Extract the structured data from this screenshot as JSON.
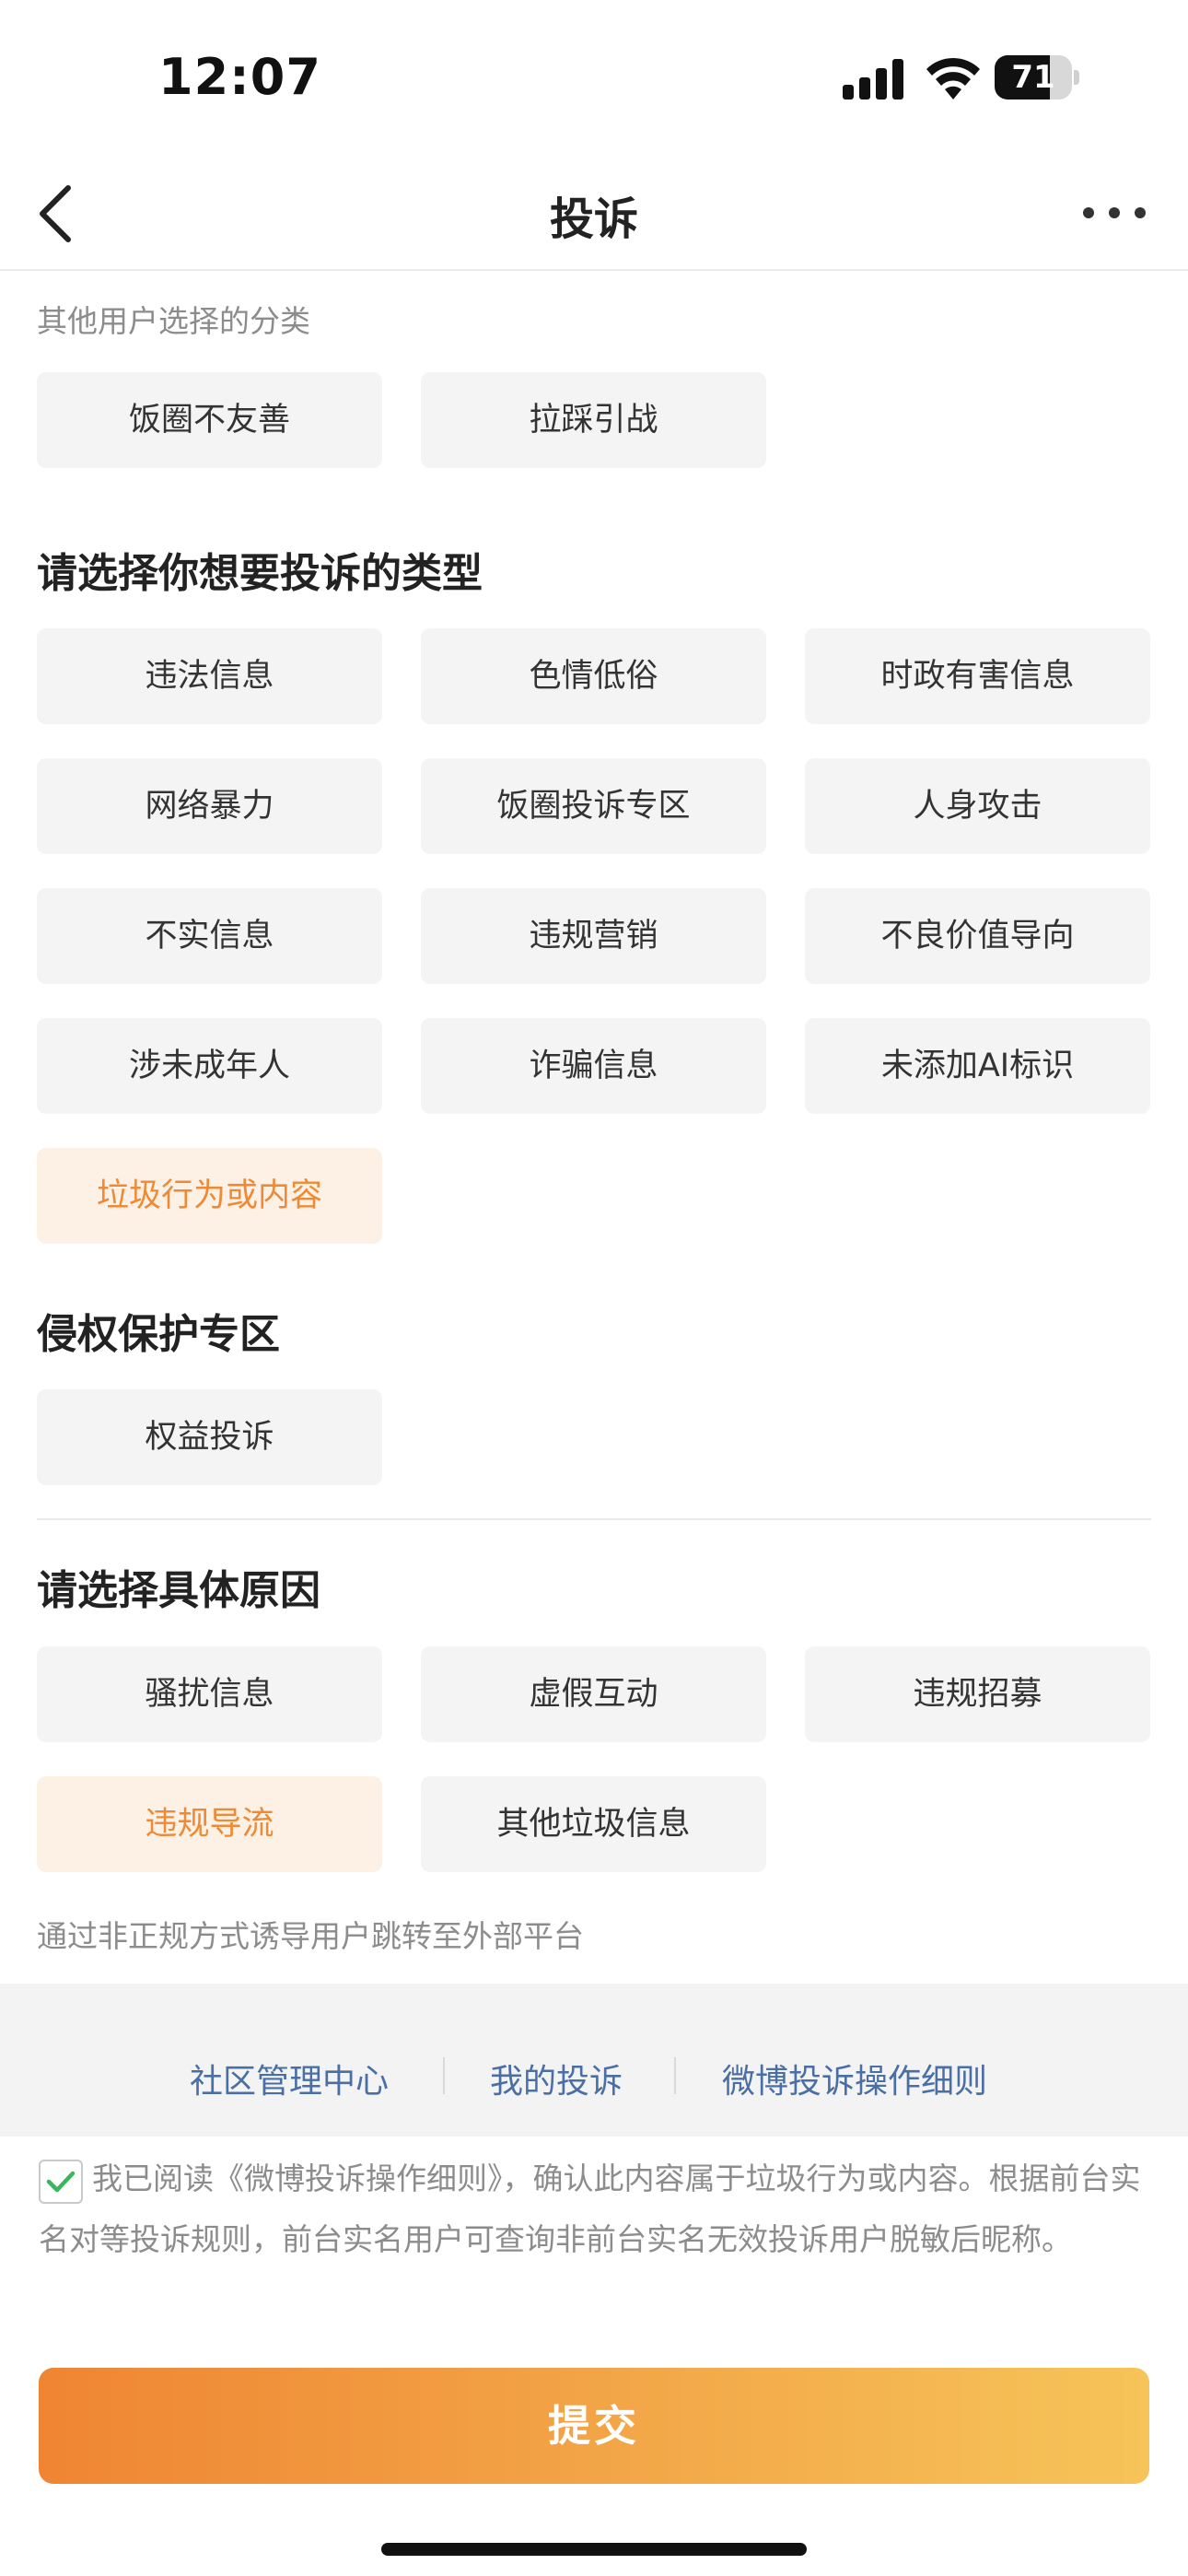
{
  "status_bar": {
    "time": "12:07",
    "battery": "71",
    "battery_level": 0.71
  },
  "nav": {
    "title": "投诉",
    "back_icon": "chevron-left-icon",
    "more_icon": "more-horizontal-icon"
  },
  "other_users": {
    "hint": "其他用户选择的分类",
    "chips": [
      "饭圈不友善",
      "拉踩引战"
    ]
  },
  "complaint_type": {
    "title": "请选择你想要投诉的类型",
    "chips": [
      "违法信息",
      "色情低俗",
      "时政有害信息",
      "网络暴力",
      "饭圈投诉专区",
      "人身攻击",
      "不实信息",
      "违规营销",
      "不良价值导向",
      "涉未成年人",
      "诈骗信息",
      "未添加AI标识",
      "垃圾行为或内容"
    ],
    "selected": "垃圾行为或内容"
  },
  "rights": {
    "title": "侵权保护专区",
    "chips": [
      "权益投诉"
    ]
  },
  "reason": {
    "title": "请选择具体原因",
    "chips": [
      "骚扰信息",
      "虚假互动",
      "违规招募",
      "违规导流",
      "其他垃圾信息"
    ],
    "selected": "违规导流",
    "description": "通过非正规方式诱导用户跳转至外部平台"
  },
  "links": [
    "社区管理中心",
    "我的投诉",
    "微博投诉操作细则"
  ],
  "agreement": {
    "checked": true,
    "text": "我已阅读《微博投诉操作细则》，确认此内容属于垃圾行为或内容。根据前台实名对等投诉规则，前台实名用户可查询非前台实名无效投诉用户脱敏后昵称。"
  },
  "submit_label": "提交",
  "colors": {
    "accent": "#ee8a35",
    "selected_bg": "#fdf1e6",
    "link": "#4a6fa5",
    "submit_start": "#ef8533",
    "submit_end": "#f6c459"
  }
}
